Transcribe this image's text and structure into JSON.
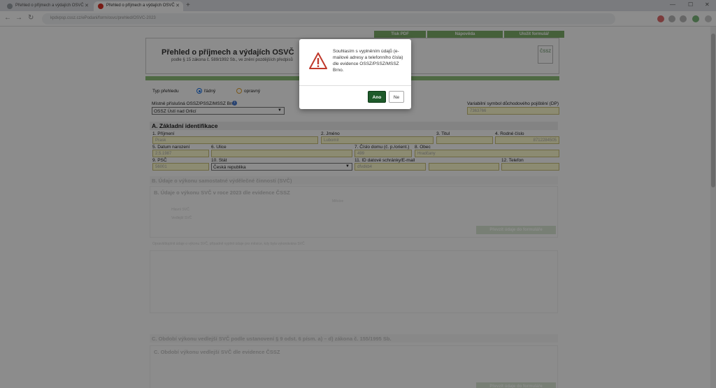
{
  "browser": {
    "tabs": [
      {
        "title": "Přehled o příjmech a výdajích OSVČ"
      },
      {
        "title": "Přehled o příjmech a výdajích OSVČ"
      }
    ],
    "url": "kpdvpsp.cssz.cz/ePodani/form/osvc/prehled/OSVC-2023"
  },
  "top_buttons": [
    {
      "label": "Tisk PDF"
    },
    {
      "label": "Nápověda"
    },
    {
      "label": "Uložit formulář"
    }
  ],
  "header": {
    "title": "Přehled o příjmech a výdajích OSVČ",
    "subtitle": "podle § 15 zákona č. 589/1992 Sb., ve znění pozdějších předpisů",
    "logo": "ČSSZ"
  },
  "form": {
    "typ_label": "Typ přehledu",
    "radnny_label": "řádný",
    "opravny_label": "opravný",
    "ossz_label": "Místně příslušná OSSZ/PSSZ/MSSZ Brno",
    "ossz_value": "OSSZ Ústí nad Orlicí",
    "vs_label": "Variabilní symbol důchodového pojištění (DP)",
    "vs_value": "7363766"
  },
  "sectionA": {
    "title": "A. Základní identifikace",
    "fields": {
      "prijmeni_label": "1. Příjmení",
      "prijmeni_value": "Prask",
      "jmeno_label": "2. Jméno",
      "jmeno_value": "Lubomír",
      "titul_label": "3. Titul",
      "rc_label": "4. Rodné číslo",
      "rc_value": "8712284505",
      "datum_label": "5. Datum narození",
      "datum_value": "2.5.1987",
      "ulice_label": "6. Ulice",
      "cislo_label": "7. Číslo domu (č. p./orient.)",
      "cislo_value": "499",
      "obec_label": "8. Obec",
      "obec_value": "Hradčany",
      "psc_label": "9. PSČ",
      "psc_value": "56001",
      "stat_label": "10. Stát",
      "stat_value": "Česká republika",
      "ds_label": "11. ID datové schránky/E-mail",
      "ds_value": "dfvdkb4",
      "tel_label": "12. Telefon"
    }
  },
  "faded": {
    "sectionB": "B. Údaje o výkonu samostatné výdělečné činnosti (SVČ)",
    "sectionB2": "B. Údaje o výkonu SVČ v roce 2023 dle evidence ČSSZ",
    "months_header": "Měsíce",
    "row1": "Hlavní SVČ",
    "row2": "Vedlejší SVČ",
    "btn1": "Převzít údaje do formuláře",
    "note": "Opravit/doplnit údaje o výkonu SVČ, případně vyplnit údaje pro měsíce, kdy byla vykonávána SVČ",
    "sectionC": "C. Období výkonu vedlejší SVČ podle ustanovení § 9 odst. 6 písm. a) – d) zákona č. 155/1995 Sb.",
    "sectionC2": "C. Období výkonu vedlejší SVČ dle evidence ČSSZ",
    "btn2": "Převzít údaje do formuláře"
  },
  "dialog": {
    "message": "Souhlasím s vyplněním údajů (e-mailové adresy a telefonního čísla) dle evidence OSSZ/PSSZ/MSSZ Brno.",
    "yes": "Ano",
    "no": "Ne",
    "icon": "warning-icon"
  }
}
